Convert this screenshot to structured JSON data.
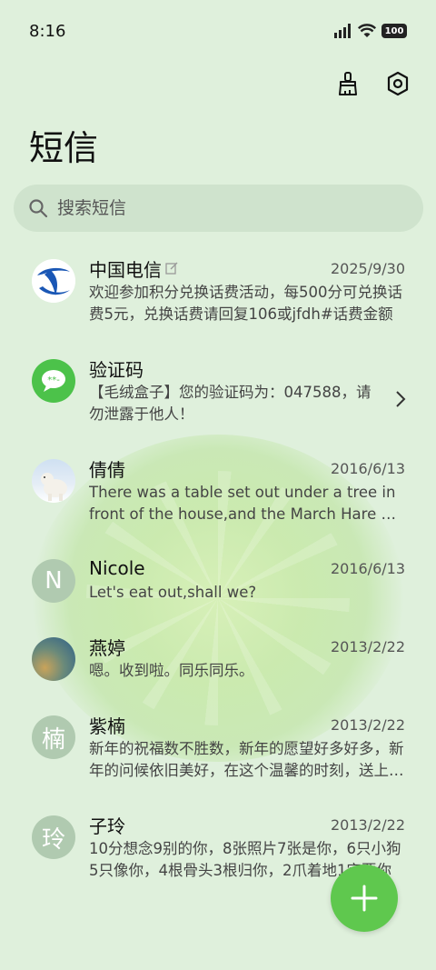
{
  "status_bar": {
    "time": "8:16",
    "battery": "100"
  },
  "header": {
    "title": "短信"
  },
  "search": {
    "placeholder": "搜索短信"
  },
  "conversations": [
    {
      "name": "中国电信",
      "date": "2025/9/30",
      "preview": "欢迎参加积分兑换话费活动，每500分可兑换话费5元，兑换话费请回复106或jfdh#话费金额"
    },
    {
      "name": "验证码",
      "date": "",
      "preview": "【毛绒盒子】您的验证码为：047588，请勿泄露于他人！"
    },
    {
      "name": "倩倩",
      "date": "2016/6/13",
      "preview": "There was a table set out under a tree in front of the house,and the March Hare and the Hatter"
    },
    {
      "name": "Nicole",
      "avatar_letter": "N",
      "date": "2016/6/13",
      "preview": "Let's eat out,shall we?"
    },
    {
      "name": "燕婷",
      "date": "2013/2/22",
      "preview": "嗯。收到啦。同乐同乐。"
    },
    {
      "name": "紫楠",
      "avatar_letter": "楠",
      "date": "2013/2/22",
      "preview": "新年的祝福数不胜数，新年的愿望好多好多，新年的问候依旧美好，在这个温馨的时刻，送上祝福"
    },
    {
      "name": "子玲",
      "avatar_letter": "玲",
      "date": "2013/2/22",
      "preview": "10分想念9别的你，8张照片7张是你，6只小狗5只像你，4根骨头3根归你，2爪着地1定要你"
    }
  ],
  "colors": {
    "background": "#dff0dc",
    "accent": "#5fc84e",
    "search_bg": "#cfe3cd"
  }
}
